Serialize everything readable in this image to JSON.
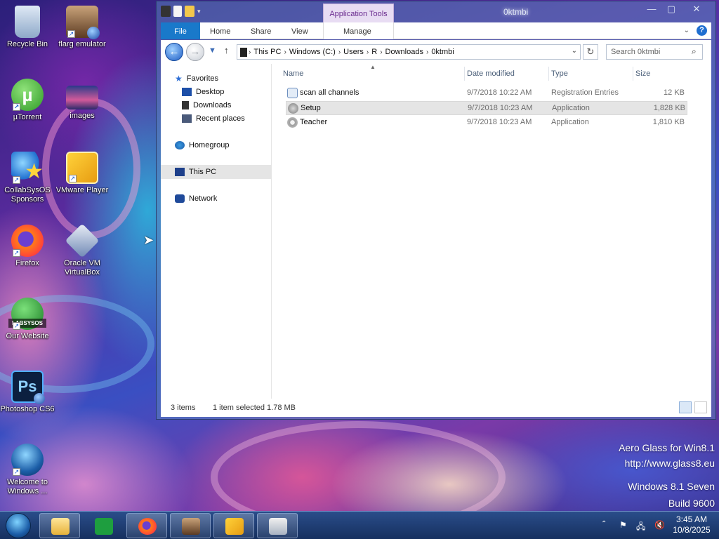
{
  "desktop": {
    "icons": [
      {
        "label": "Recycle Bin",
        "icon": "recycle-bin-icon"
      },
      {
        "label": "flarg emulator",
        "icon": "flarg-emulator-icon"
      },
      {
        "label": "µTorrent",
        "icon": "utorrent-icon"
      },
      {
        "label": "images",
        "icon": "images-icon"
      },
      {
        "label": "CollabSysOS Sponsors",
        "icon": "collabsysos-sponsors-icon"
      },
      {
        "label": "VMware Player",
        "icon": "vmware-player-icon"
      },
      {
        "label": "Firefox",
        "icon": "firefox-icon"
      },
      {
        "label": "Oracle VM VirtualBox",
        "icon": "virtualbox-icon"
      },
      {
        "label": "Our Website",
        "icon": "our-website-icon"
      },
      {
        "label": "Photoshop CS6",
        "icon": "photoshop-icon"
      },
      {
        "label": "Welcome to Windows ...",
        "icon": "windows-icon"
      }
    ],
    "labsysos_text": "LABSYSOS",
    "ps_text": "Ps"
  },
  "window": {
    "title": "0ktmbi",
    "app_tools_label": "Application Tools",
    "ribbon_tabs": [
      "File",
      "Home",
      "Share",
      "View",
      "Manage"
    ],
    "help_label": "?",
    "breadcrumb": [
      "This PC",
      "Windows (C:)",
      "Users",
      "R",
      "Downloads",
      "0ktmbi"
    ],
    "search_placeholder": "Search 0ktmbi",
    "nav_pane": {
      "favorites": "Favorites",
      "favorites_items": [
        "Desktop",
        "Downloads",
        "Recent places"
      ],
      "homegroup": "Homegroup",
      "this_pc": "This PC",
      "network": "Network"
    },
    "columns": [
      "Name",
      "Date modified",
      "Type",
      "Size"
    ],
    "files": [
      {
        "name": "scan all channels",
        "date": "9/7/2018 10:22 AM",
        "type": "Registration Entries",
        "size": "12 KB",
        "icon": "registry-file-icon",
        "selected": false
      },
      {
        "name": "Setup",
        "date": "9/7/2018 10:23 AM",
        "type": "Application",
        "size": "1,828 KB",
        "icon": "setup-app-icon",
        "selected": true
      },
      {
        "name": "Teacher",
        "date": "9/7/2018 10:23 AM",
        "type": "Application",
        "size": "1,810 KB",
        "icon": "teacher-app-icon",
        "selected": false
      }
    ],
    "status": {
      "item_count": "3 items",
      "selection": "1 item selected  1.78 MB"
    }
  },
  "watermark": {
    "line1": "Aero Glass for Win8.1",
    "line2": "http://www.glass8.eu",
    "line3": "Windows 8.1 Seven",
    "line4": "Build 9600"
  },
  "taskbar": {
    "pinned": [
      "file-explorer-icon",
      "store-icon",
      "firefox-icon",
      "flarg-emulator-icon",
      "vmware-icon",
      "archive-app-icon"
    ],
    "clock_time": "3:45 AM",
    "clock_date": "10/8/2025"
  },
  "colors": {
    "accent": "#1979ca",
    "selection": "#e5e5e5",
    "app_tools": "#6a2b8f"
  }
}
